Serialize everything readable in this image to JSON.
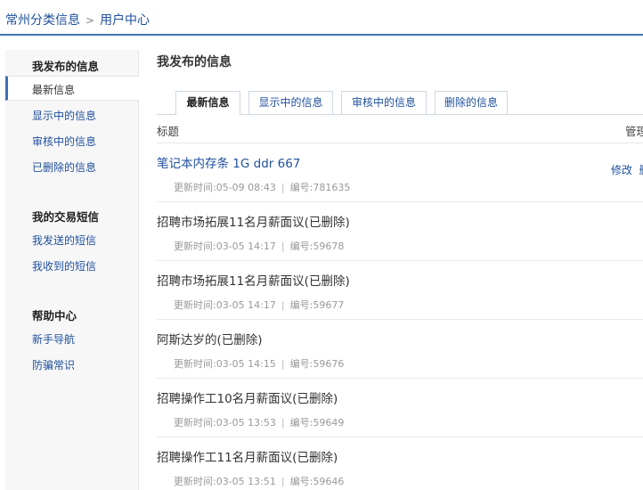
{
  "breadcrumb": {
    "site": "常州分类信息",
    "separator": ">",
    "current": "用户中心"
  },
  "sidebar": {
    "groups": [
      {
        "title": "我发布的信息",
        "items": [
          "最新信息",
          "显示中的信息",
          "审核中的信息",
          "已删除的信息"
        ]
      },
      {
        "title": "我的交易短信",
        "items": [
          "我发送的短信",
          "我收到的短信"
        ]
      },
      {
        "title": "帮助中心",
        "items": [
          "新手导航",
          "防骗常识"
        ]
      }
    ],
    "active_item": "最新信息"
  },
  "main": {
    "title": "我发布的信息",
    "tabs": [
      {
        "label": "最新信息",
        "active": true
      },
      {
        "label": "显示中的信息",
        "active": false
      },
      {
        "label": "审核中的信息",
        "active": false
      },
      {
        "label": "删除的信息",
        "active": false
      }
    ],
    "columns": {
      "title": "标题",
      "manage": "管理"
    },
    "labels": {
      "updated": "更新时间:",
      "number": "编号:",
      "divider": "|"
    },
    "rows": [
      {
        "title": "笔记本内存条 1G ddr 667",
        "updated": "05-09 08:43",
        "number": "781635",
        "action": "修改",
        "action_more": "删"
      },
      {
        "title": "招聘市场拓展11名月薪面议(已删除)",
        "updated": "03-05 14:17",
        "number": "59678"
      },
      {
        "title": "招聘市场拓展11名月薪面议(已删除)",
        "updated": "03-05 14:17",
        "number": "59677"
      },
      {
        "title": "阿斯达岁的(已删除)",
        "updated": "03-05 14:15",
        "number": "59676"
      },
      {
        "title": "招聘操作工10名月薪面议(已删除)",
        "updated": "03-05 13:53",
        "number": "59649"
      },
      {
        "title": "招聘操作工11名月薪面议(已删除)",
        "updated": "03-05 13:51",
        "number": "59646"
      }
    ]
  }
}
